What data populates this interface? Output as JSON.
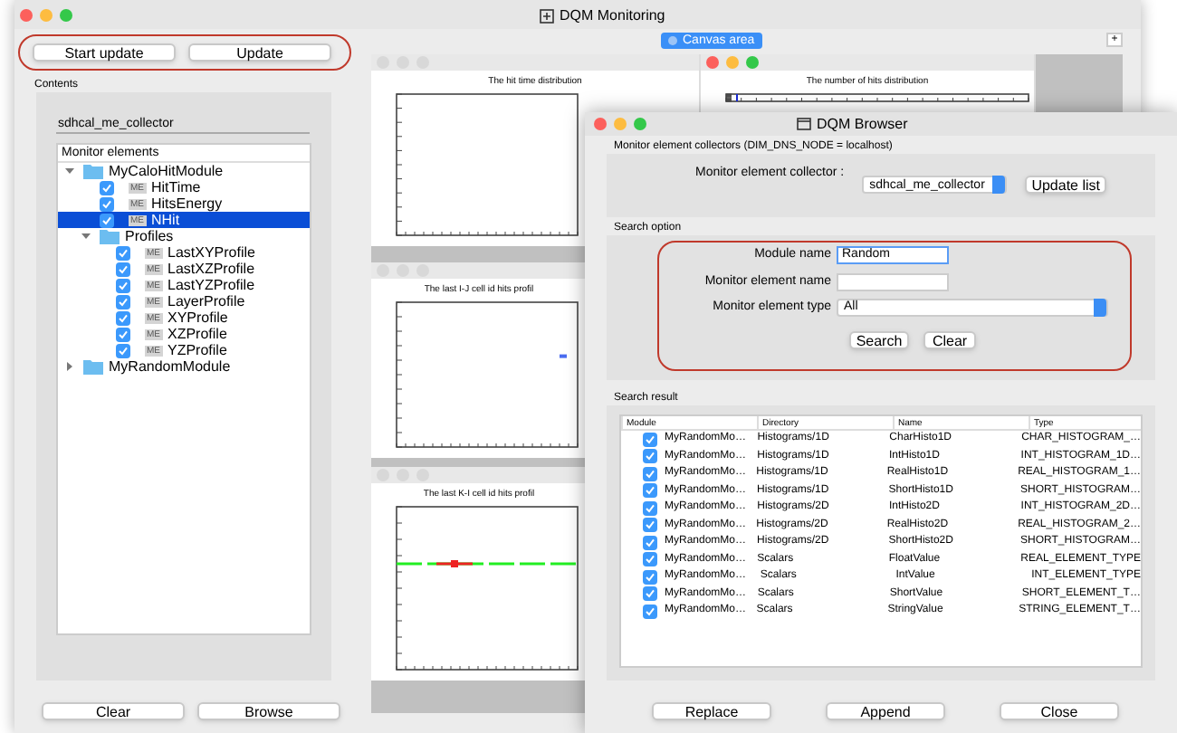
{
  "main_window": {
    "title": "DQM Monitoring",
    "top_buttons": [
      "Start update",
      "Update"
    ],
    "contents_label": "Contents",
    "collector_tab": "sdhcal_me_collector",
    "tree_header": "Monitor elements",
    "tree": [
      {
        "kind": "folder",
        "label": "MyCaloHitModule",
        "expanded": true,
        "children": [
          {
            "kind": "element",
            "label": "HitTime",
            "tag": "ME",
            "checked": true,
            "selected": false
          },
          {
            "kind": "element",
            "label": "HitsEnergy",
            "tag": "ME",
            "checked": true,
            "selected": false
          },
          {
            "kind": "element",
            "label": "NHit",
            "tag": "ME",
            "checked": true,
            "selected": true
          },
          {
            "kind": "folder",
            "label": "Profiles",
            "expanded": true,
            "children": [
              {
                "kind": "element",
                "label": "LastXYProfile",
                "tag": "ME",
                "checked": true,
                "selected": false
              },
              {
                "kind": "element",
                "label": "LastXZProfile",
                "tag": "ME",
                "checked": true,
                "selected": false
              },
              {
                "kind": "element",
                "label": "LastYZProfile",
                "tag": "ME",
                "checked": true,
                "selected": false
              },
              {
                "kind": "element",
                "label": "LayerProfile",
                "tag": "ME",
                "checked": true,
                "selected": false
              },
              {
                "kind": "element",
                "label": "XYProfile",
                "tag": "ME",
                "checked": true,
                "selected": false
              },
              {
                "kind": "element",
                "label": "XZProfile",
                "tag": "ME",
                "checked": true,
                "selected": false
              },
              {
                "kind": "element",
                "label": "YZProfile",
                "tag": "ME",
                "checked": true,
                "selected": false
              }
            ]
          }
        ]
      },
      {
        "kind": "folder",
        "label": "MyRandomModule",
        "expanded": false
      }
    ],
    "bottom_buttons": [
      "Clear",
      "Browse"
    ]
  },
  "canvas": {
    "tab": "Canvas area",
    "add_button": "+",
    "plots": [
      {
        "title": "The hit time distribution",
        "kind": "empty"
      },
      {
        "title": "The number of hits distribution",
        "kind": "spike"
      },
      {
        "title": "The last I-J cell id hits profil",
        "kind": "dot"
      },
      {
        "title": "The last K-I cell id hits profil",
        "kind": "dashes"
      }
    ]
  },
  "browser": {
    "title": "DQM Browser",
    "collectors_label": "Monitor element collectors (DIM_DNS_NODE = localhost)",
    "collector_label": "Monitor element collector :",
    "collector_value": "sdhcal_me_collector",
    "update_button": "Update list",
    "search_label": "Search option",
    "module_name_label": "Module name",
    "module_name_value": "Random",
    "element_name_label": "Monitor element name",
    "element_type_label": "Monitor element type",
    "element_type_value": "All",
    "search_button": "Search",
    "clear_button": "Clear",
    "result_label": "Search result",
    "columns": [
      "Module",
      "Directory",
      "Name",
      "Type"
    ],
    "rows": [
      {
        "checked": true,
        "cells": [
          "MyRandomMo…",
          "Histograms/1D",
          "CharHisto1D",
          "CHAR_HISTOGRAM_…"
        ]
      },
      {
        "checked": true,
        "cells": [
          "MyRandomMo…",
          "Histograms/1D",
          "IntHisto1D",
          "INT_HISTOGRAM_1D…"
        ]
      },
      {
        "checked": true,
        "cells": [
          "MyRandomMo…",
          "Histograms/1D",
          "RealHisto1D",
          "REAL_HISTOGRAM_1…"
        ]
      },
      {
        "checked": true,
        "cells": [
          "MyRandomMo…",
          "Histograms/1D",
          "ShortHisto1D",
          "SHORT_HISTOGRAM…"
        ]
      },
      {
        "checked": true,
        "cells": [
          "MyRandomMo…",
          "Histograms/2D",
          "IntHisto2D",
          "INT_HISTOGRAM_2D…"
        ]
      },
      {
        "checked": true,
        "cells": [
          "MyRandomMo…",
          "Histograms/2D",
          "RealHisto2D",
          "REAL_HISTOGRAM_2…"
        ]
      },
      {
        "checked": true,
        "cells": [
          "MyRandomMo…",
          "Histograms/2D",
          "ShortHisto2D",
          "SHORT_HISTOGRAM…"
        ]
      },
      {
        "checked": true,
        "cells": [
          "MyRandomMo…",
          "Scalars",
          "FloatValue",
          "REAL_ELEMENT_TYPE"
        ]
      },
      {
        "checked": true,
        "cells": [
          "MyRandomMo…",
          "Scalars",
          "IntValue",
          "INT_ELEMENT_TYPE"
        ]
      },
      {
        "checked": true,
        "cells": [
          "MyRandomMo…",
          "Scalars",
          "ShortValue",
          "SHORT_ELEMENT_T…"
        ]
      },
      {
        "checked": true,
        "cells": [
          "MyRandomMo…",
          "Scalars",
          "StringValue",
          "STRING_ELEMENT_T…"
        ]
      }
    ],
    "bottom_buttons": [
      "Replace",
      "Append",
      "Close"
    ]
  }
}
